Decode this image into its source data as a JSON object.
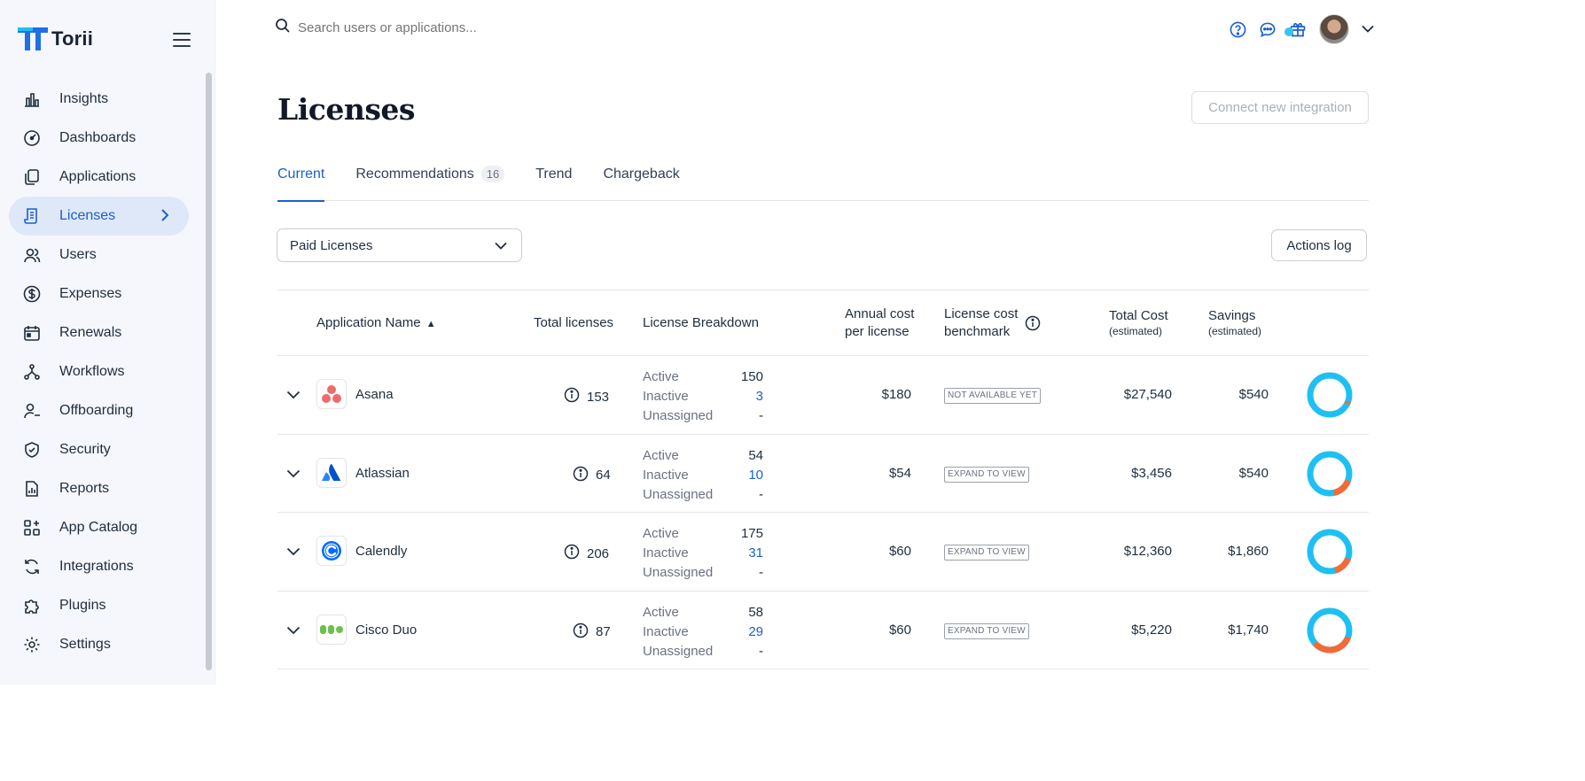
{
  "app": {
    "name": "Torii"
  },
  "search": {
    "placeholder": "Search users or applications..."
  },
  "sidebar": {
    "items": [
      {
        "label": "Insights",
        "icon": "insights-icon"
      },
      {
        "label": "Dashboards",
        "icon": "dashboard-icon"
      },
      {
        "label": "Applications",
        "icon": "applications-icon"
      },
      {
        "label": "Licenses",
        "icon": "licenses-icon",
        "active": true
      },
      {
        "label": "Users",
        "icon": "users-icon"
      },
      {
        "label": "Expenses",
        "icon": "dollar-icon"
      },
      {
        "label": "Renewals",
        "icon": "calendar-icon"
      },
      {
        "label": "Workflows",
        "icon": "workflow-icon"
      },
      {
        "label": "Offboarding",
        "icon": "offboarding-icon"
      },
      {
        "label": "Security",
        "icon": "shield-icon"
      },
      {
        "label": "Reports",
        "icon": "reports-icon"
      },
      {
        "label": "App Catalog",
        "icon": "catalog-icon"
      },
      {
        "label": "Integrations",
        "icon": "integrations-icon"
      },
      {
        "label": "Plugins",
        "icon": "puzzle-icon"
      },
      {
        "label": "Settings",
        "icon": "gear-icon"
      }
    ]
  },
  "page": {
    "title": "Licenses",
    "connect_label": "Connect new integration",
    "tabs": [
      {
        "label": "Current",
        "active": true
      },
      {
        "label": "Recommendations",
        "badge": "16"
      },
      {
        "label": "Trend"
      },
      {
        "label": "Chargeback"
      }
    ],
    "filter_value": "Paid Licenses",
    "actions_label": "Actions log"
  },
  "table": {
    "headers": {
      "app_name": "Application Name",
      "sort_indicator": "▲",
      "total": "Total licenses",
      "breakdown": "License Breakdown",
      "annual_1": "Annual cost",
      "annual_2": "per license",
      "bench_1": "License cost",
      "bench_2": "benchmark",
      "tcost": "Total Cost",
      "tcost_sub": "(estimated)",
      "savings": "Savings",
      "savings_sub": "(estimated)"
    },
    "breakdown_labels": {
      "active": "Active",
      "inactive": "Inactive",
      "unassigned": "Unassigned"
    },
    "rows": [
      {
        "name": "Asana",
        "total": "153",
        "active": "150",
        "inactive": "3",
        "unassigned": "-",
        "annual": "$180",
        "benchmark": "NOT AVAILABLE YET",
        "total_cost": "$27,540",
        "savings": "$540",
        "inactive_share": 0.02
      },
      {
        "name": "Atlassian",
        "total": "64",
        "active": "54",
        "inactive": "10",
        "unassigned": "-",
        "annual": "$54",
        "benchmark": "EXPAND TO VIEW",
        "total_cost": "$3,456",
        "savings": "$540",
        "inactive_share": 0.16
      },
      {
        "name": "Calendly",
        "total": "206",
        "active": "175",
        "inactive": "31",
        "unassigned": "-",
        "annual": "$60",
        "benchmark": "EXPAND TO VIEW",
        "total_cost": "$12,360",
        "savings": "$1,860",
        "inactive_share": 0.15
      },
      {
        "name": "Cisco Duo",
        "total": "87",
        "active": "58",
        "inactive": "29",
        "unassigned": "-",
        "annual": "$60",
        "benchmark": "EXPAND TO VIEW",
        "total_cost": "$5,220",
        "savings": "$1,740",
        "inactive_share": 0.33
      }
    ],
    "donut_colors": {
      "active": "#1ec0f2",
      "inactive": "#f26a35"
    }
  }
}
